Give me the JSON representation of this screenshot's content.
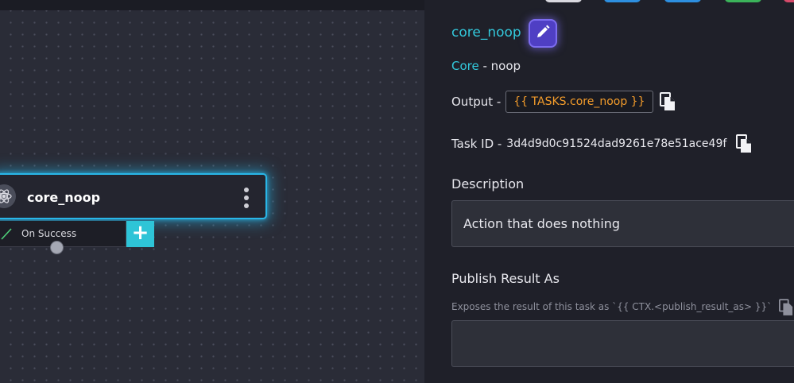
{
  "canvas": {
    "node": {
      "title": "core_noop",
      "icon": "atom-icon",
      "menu_icon": "more-vertical-icon"
    },
    "branch": {
      "label": "On Success",
      "add_label": "+",
      "check_icon": "check-icon"
    }
  },
  "panel": {
    "task_name": "core_noop",
    "edit_icon": "pencil-icon",
    "reference": {
      "pack": "Core",
      "separator_action": " - noop"
    },
    "output": {
      "label": "Output - ",
      "value": "{{ TASKS.core_noop }}",
      "copy_icon": "copy-icon"
    },
    "task_id": {
      "label": "Task ID - ",
      "value": "3d4d9d0c91524dad9261e78e51ace49f",
      "copy_icon": "copy-icon"
    },
    "description": {
      "title": "Description",
      "value": "Action that does nothing"
    },
    "publish": {
      "title": "Publish Result As",
      "hint": "Exposes the result of this task as `{{ CTX.<publish_result_as> }}`",
      "value": ""
    }
  },
  "colors": {
    "accent_cyan": "#33c9dc",
    "node_glow": "#29b6e8",
    "output_orange": "#f39c2b",
    "edit_purple": "#7c6cf0"
  }
}
